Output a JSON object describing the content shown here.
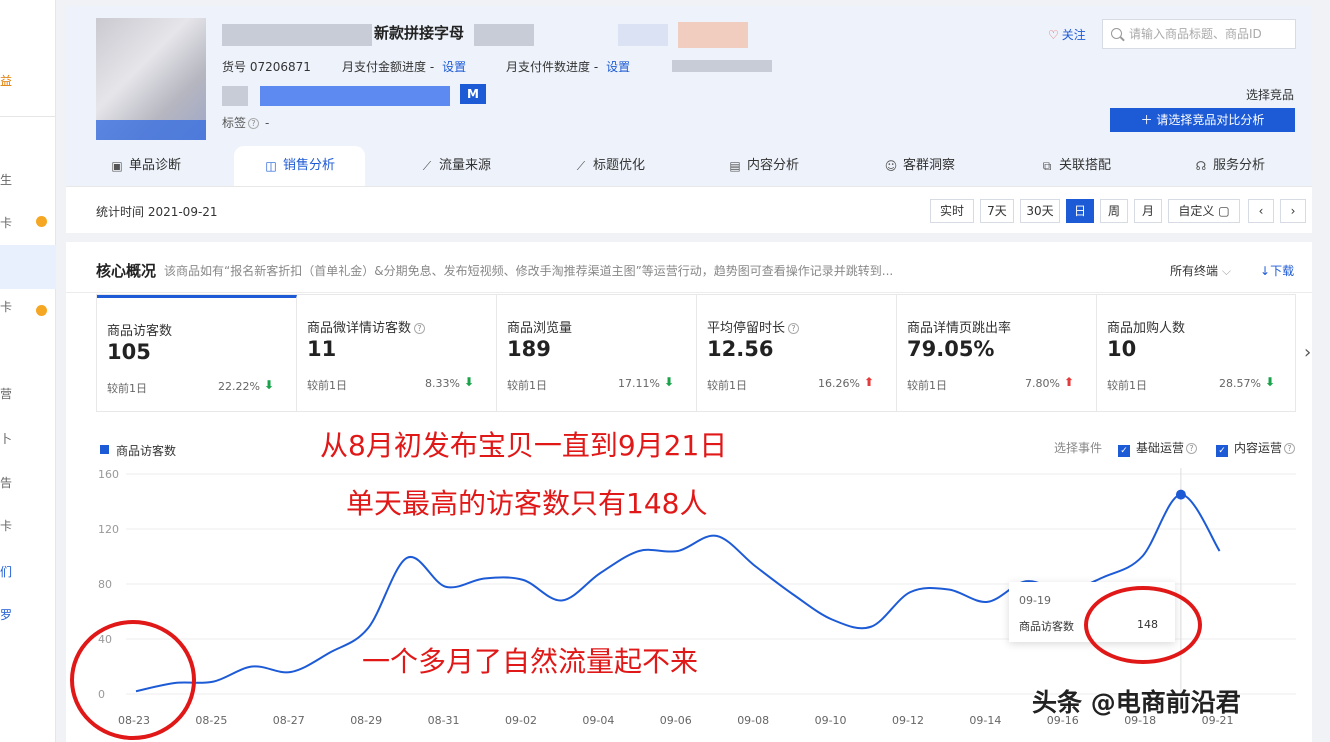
{
  "left_nav": {
    "glyphs": [
      "益",
      "生",
      "卡",
      "卡",
      "营",
      "卜",
      "告",
      "卡",
      "们",
      "罗"
    ]
  },
  "product": {
    "title_fragment": "新款拼接字母",
    "item_no": "货号 07206871",
    "amount_progress_label": "月支付金额进度 -",
    "amount_progress_link": "设置",
    "count_progress_label": "月支付件数进度 -",
    "count_progress_link": "设置",
    "badge": "M",
    "tag_label": "标签",
    "tag_value": "-",
    "follow": "关注",
    "search_placeholder": "请输入商品标题、商品ID",
    "choose_label": "选择竞品",
    "compare_button": "请选择竞品对比分析"
  },
  "tabs": [
    {
      "label": "单品诊断",
      "icon": "medkit-icon"
    },
    {
      "label": "销售分析",
      "icon": "bag-icon"
    },
    {
      "label": "流量来源",
      "icon": "line-chart-icon"
    },
    {
      "label": "标题优化",
      "icon": "line-chart-icon"
    },
    {
      "label": "内容分析",
      "icon": "document-icon"
    },
    {
      "label": "客群洞察",
      "icon": "users-icon"
    },
    {
      "label": "关联搭配",
      "icon": "link-icon"
    },
    {
      "label": "服务分析",
      "icon": "headset-icon"
    }
  ],
  "stats": {
    "date": "统计时间 2021-09-21",
    "ranges": [
      "实时",
      "7天",
      "30天",
      "日",
      "周",
      "月",
      "自定义"
    ],
    "active_range": "日",
    "prev": "‹",
    "next": "›"
  },
  "core": {
    "title": "核心概况",
    "desc": "该商品如有“报名新客折扣（首单礼金）&分期免息、发布短视频、修改手淘推荐渠道主图”等运营行动，趋势图可查看操作记录并跳转到...",
    "all_terminals": "所有终端",
    "download": "下载",
    "metrics": [
      {
        "name": "商品访客数",
        "value": "105",
        "compare": "较前1日",
        "pct": "22.22%",
        "dir": "down",
        "q": false
      },
      {
        "name": "商品微详情访客数",
        "value": "11",
        "compare": "较前1日",
        "pct": "8.33%",
        "dir": "down",
        "q": true
      },
      {
        "name": "商品浏览量",
        "value": "189",
        "compare": "较前1日",
        "pct": "17.11%",
        "dir": "down",
        "q": false
      },
      {
        "name": "平均停留时长",
        "value": "12.56",
        "compare": "较前1日",
        "pct": "16.26%",
        "dir": "up",
        "q": true
      },
      {
        "name": "商品详情页跳出率",
        "value": "79.05%",
        "compare": "较前1日",
        "pct": "7.80%",
        "dir": "up",
        "q": false
      },
      {
        "name": "商品加购人数",
        "value": "10",
        "compare": "较前1日",
        "pct": "28.57%",
        "dir": "down",
        "q": false
      }
    ],
    "events_label": "选择事件",
    "event_checks": [
      "基础运营",
      "内容运营"
    ],
    "tooltip": {
      "date": "09-19",
      "key": "商品访客数",
      "value": "148"
    }
  },
  "chart_data": {
    "type": "line",
    "series": [
      {
        "name": "商品访客数",
        "color": "#1d5bd6"
      }
    ],
    "x": [
      "08-23",
      "08-24",
      "08-25",
      "08-26",
      "08-27",
      "08-28",
      "08-29",
      "08-30",
      "08-31",
      "09-01",
      "09-02",
      "09-03",
      "09-04",
      "09-05",
      "09-06",
      "09-07",
      "09-08",
      "09-09",
      "09-10",
      "09-11",
      "09-12",
      "09-13",
      "09-14",
      "09-15",
      "09-16",
      "09-17",
      "09-18",
      "09-19",
      "09-20"
    ],
    "values": [
      2,
      8,
      9,
      20,
      16,
      30,
      48,
      99,
      78,
      84,
      83,
      68,
      88,
      104,
      104,
      115,
      93,
      72,
      54,
      49,
      74,
      76,
      67,
      82,
      75,
      85,
      100,
      145,
      104
    ],
    "x_tick_labels": [
      "08-23",
      "08-25",
      "08-27",
      "08-29",
      "08-31",
      "09-02",
      "09-04",
      "09-06",
      "09-08",
      "09-10",
      "09-12",
      "09-14",
      "09-16",
      "09-18",
      "09-21"
    ],
    "y_ticks": [
      0,
      40,
      80,
      120,
      160
    ],
    "ylim": [
      0,
      160
    ],
    "highlight_index": 27,
    "grid": "horizontal"
  },
  "annotations": {
    "line1": "从8月初发布宝贝一直到9月21日",
    "line2": "单天最高的访客数只有148人",
    "line3": "一个多月了自然流量起不来",
    "watermark": "头条 @电商前沿君"
  }
}
